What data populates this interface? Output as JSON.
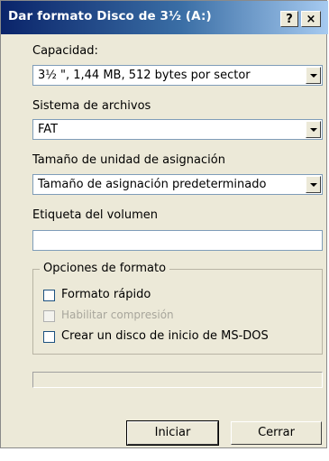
{
  "window": {
    "title": "Dar formato Disco de 3½ (A:)",
    "help_button": "?",
    "close_button": "×"
  },
  "capacity": {
    "label": "Capacidad:",
    "value": "3½ \", 1,44 MB, 512 bytes por sector"
  },
  "filesystem": {
    "label": "Sistema de archivos",
    "value": "FAT"
  },
  "allocation": {
    "label": "Tamaño de unidad de asignación",
    "value": "Tamaño de asignación predeterminado"
  },
  "volume": {
    "label": "Etiqueta del volumen",
    "value": ""
  },
  "format_options": {
    "title": "Opciones de formato",
    "quick_format": {
      "label": "Formato rápido",
      "checked": false,
      "enabled": true
    },
    "compression": {
      "label": "Habilitar compresión",
      "checked": false,
      "enabled": false
    },
    "msdos_boot": {
      "label": "Crear un disco de inicio de MS-DOS",
      "checked": false,
      "enabled": true
    }
  },
  "progress": {
    "value": 0
  },
  "buttons": {
    "start": "Iniciar",
    "close": "Cerrar"
  },
  "colors": {
    "titlebar_start": "#0a246a",
    "titlebar_end": "#a6caf0",
    "dialog_bg": "#ece9d8"
  }
}
